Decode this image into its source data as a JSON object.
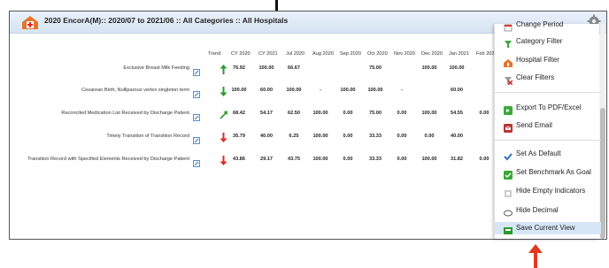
{
  "header": {
    "title": "2020 EncorA(M):: 2020/07 to 2021/06 :: All Categories :: All Hospitals"
  },
  "table": {
    "columns": [
      "Trend",
      "CY 2020",
      "CY 2021",
      "Jul 2020",
      "Aug 2020",
      "Sep 2020",
      "Oct 2020",
      "Nov 2020",
      "Dec 2020",
      "Jan 2021",
      "Feb 202"
    ],
    "rows": [
      {
        "label": "Exclusive Breast Milk Feeding",
        "trend": "up-green",
        "values": [
          "76.92",
          "100.00",
          "66.67",
          "",
          "",
          "75.00",
          "",
          "100.00",
          "100.00",
          ""
        ]
      },
      {
        "label": "Cesarean Birth, Nulliparous vertex singleton term",
        "trend": "down-green",
        "values": [
          "100.00",
          "60.00",
          "100.00",
          "-",
          "100.00",
          "100.00",
          "-",
          "",
          "60.00",
          ""
        ]
      },
      {
        "label": "Reconciled Medication List Received by Discharge Patient",
        "trend": "diag-up-green",
        "values": [
          "68.42",
          "54.17",
          "62.50",
          "100.00",
          "0.00",
          "75.00",
          "0.00",
          "100.00",
          "54.55",
          "0.00"
        ]
      },
      {
        "label": "Timely Transition of Transition Record",
        "trend": "down-red",
        "values": [
          "35.79",
          "40.00",
          "6.25",
          "100.00",
          "0.00",
          "33.33",
          "0.00",
          "0.00",
          "40.00",
          ""
        ]
      },
      {
        "label": "Transition Record with Specified Elements Received by Discharge Patient",
        "trend": "down-red",
        "values": [
          "43.86",
          "29.17",
          "43.75",
          "100.00",
          "0.00",
          "33.33",
          "0.00",
          "100.00",
          "31.82",
          "0.00"
        ]
      }
    ]
  },
  "menu": {
    "items": [
      {
        "label": "Change Period",
        "icon": "calendar-icon"
      },
      {
        "label": "Category Filter",
        "icon": "filter-icon"
      },
      {
        "label": "Hospital Filter",
        "icon": "hospital-icon"
      },
      {
        "label": "Clear Filters",
        "icon": "clear-filter-icon"
      },
      {
        "label": "Export To PDF/Excel",
        "icon": "export-icon"
      },
      {
        "label": "Send Email",
        "icon": "email-icon"
      },
      {
        "label": "Set As Default",
        "icon": "checkmark-icon"
      },
      {
        "label": "Set Benchmark As Goal",
        "icon": "benchmark-icon"
      },
      {
        "label": "Hide Empty Indicators",
        "icon": "hide-empty-icon"
      },
      {
        "label": "Hide Decimal",
        "icon": "decimal-icon"
      },
      {
        "label": "Save Current View",
        "icon": "save-view-icon"
      }
    ]
  },
  "colors": {
    "accent": "#2b74c8",
    "up": "#2b9a2b",
    "down": "#e02a1f",
    "arrow": "#e03a1e"
  }
}
